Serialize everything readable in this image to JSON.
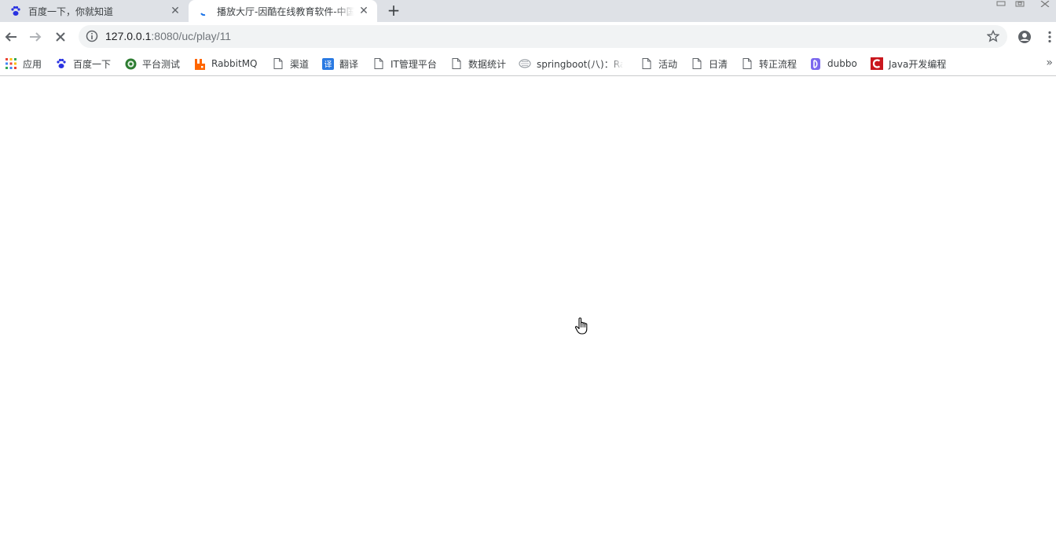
{
  "tabs": [
    {
      "title": "百度一下，你就知道",
      "favicon": "baidu-paw-icon",
      "active": false
    },
    {
      "title": "播放大厅-因酷在线教育软件-中国",
      "favicon": "loading-spinner-icon",
      "active": true
    }
  ],
  "toolbar": {
    "url_host": "127.0.0.1",
    "url_path": ":8080/uc/play/11"
  },
  "bookmarks": [
    {
      "label": "应用",
      "icon": "apps-grid-icon"
    },
    {
      "label": "百度一下",
      "icon": "baidu-paw-icon"
    },
    {
      "label": "平台测试",
      "icon": "globe-icon"
    },
    {
      "label": "RabbitMQ",
      "icon": "rabbitmq-icon"
    },
    {
      "label": "渠道",
      "icon": "page-icon"
    },
    {
      "label": "翻译",
      "icon": "translate-icon"
    },
    {
      "label": "IT管理平台",
      "icon": "page-icon"
    },
    {
      "label": "数据统计",
      "icon": "page-icon"
    },
    {
      "label": "springboot(八)：Ra",
      "icon": "blog-icon"
    },
    {
      "label": "活动",
      "icon": "page-icon"
    },
    {
      "label": "日清",
      "icon": "page-icon"
    },
    {
      "label": "转正流程",
      "icon": "page-icon"
    },
    {
      "label": "dubbo",
      "icon": "dubbo-icon"
    },
    {
      "label": "Java开发编程",
      "icon": "csdn-icon"
    }
  ],
  "colors": {
    "tabstrip": "#dee1e6",
    "omnibox": "#f1f3f4",
    "baidu_blue": "#2932e1",
    "rabbit_orange": "#f60",
    "translate_blue": "#2a7ae2",
    "dubbo_purple": "#7b68ee",
    "csdn_red": "#c9171e"
  }
}
